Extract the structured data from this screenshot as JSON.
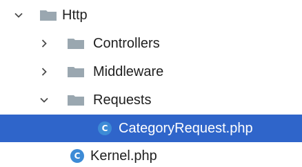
{
  "colors": {
    "selected_background": "#2f65ca",
    "folder": "#9aa7b0",
    "class_icon": "#3d8bd6",
    "chevron": "#4a4a4a"
  },
  "tree": {
    "root": {
      "label": "Http",
      "icon": "folder-icon",
      "expanded": true
    },
    "controllers": {
      "label": "Controllers",
      "icon": "folder-icon",
      "expanded": false
    },
    "middleware": {
      "label": "Middleware",
      "icon": "folder-icon",
      "expanded": false
    },
    "requests": {
      "label": "Requests",
      "icon": "folder-icon",
      "expanded": true
    },
    "category_request": {
      "label": "CategoryRequest.php",
      "icon": "php-class-icon",
      "icon_letter": "C",
      "selected": true
    },
    "kernel": {
      "label": "Kernel.php",
      "icon": "php-class-icon",
      "icon_letter": "C",
      "selected": false
    }
  }
}
